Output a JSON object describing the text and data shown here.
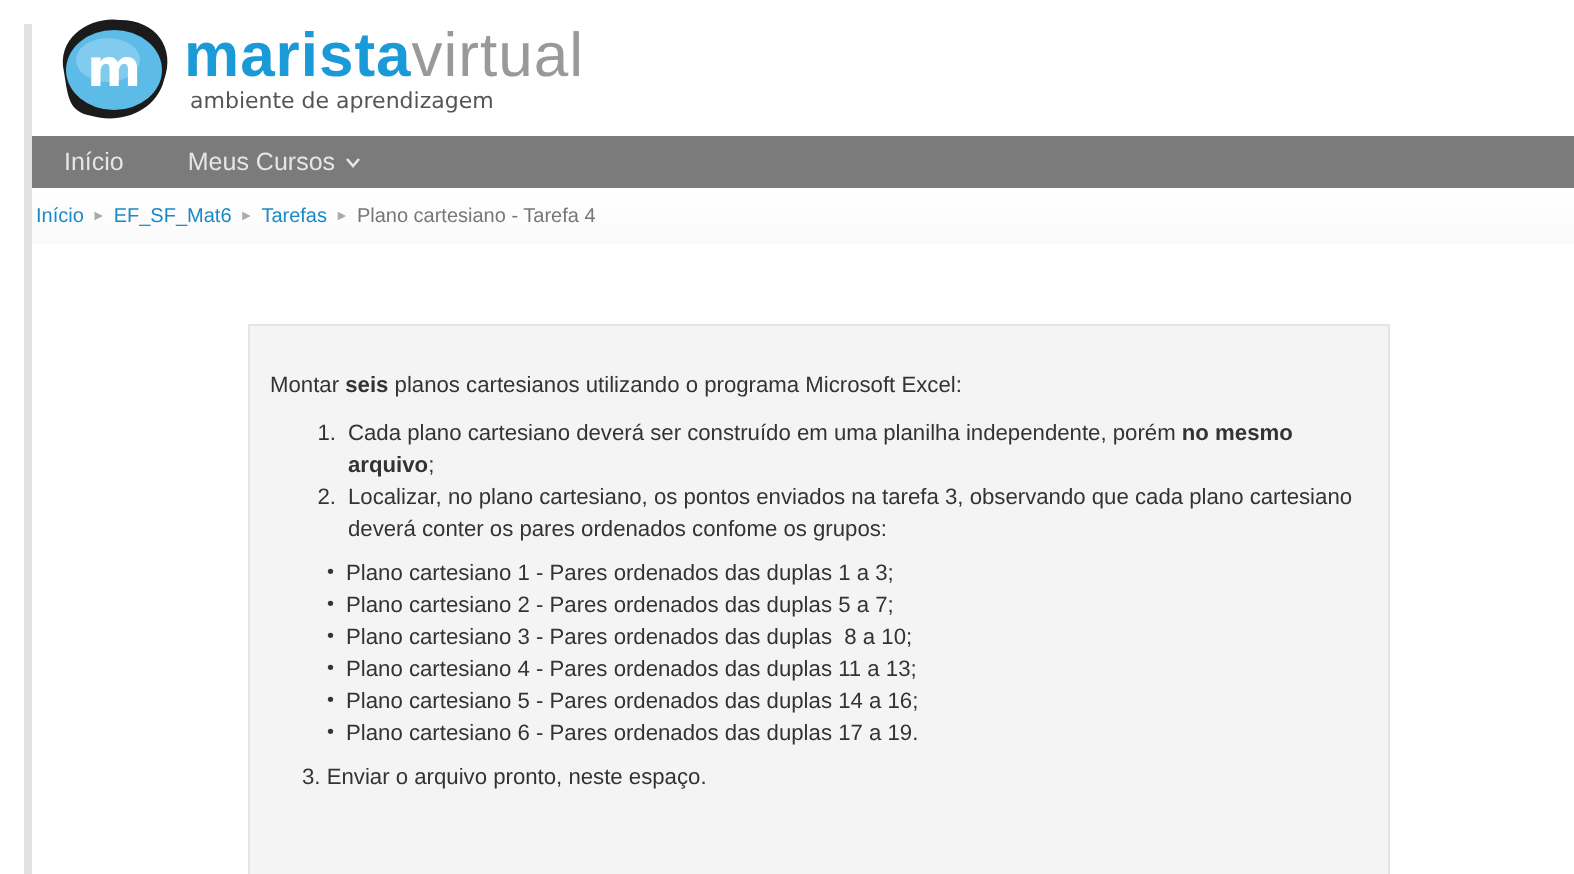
{
  "logo": {
    "brand_bold": "marista",
    "brand_light": "virtual",
    "tagline": "ambiente de aprendizagem",
    "mark": "m"
  },
  "nav": [
    {
      "label": "Início",
      "dropdown": false
    },
    {
      "label": "Meus Cursos",
      "dropdown": true
    }
  ],
  "breadcrumb": [
    {
      "label": "Início",
      "link": true
    },
    {
      "label": "EF_SF_Mat6",
      "link": true
    },
    {
      "label": "Tarefas",
      "link": true
    },
    {
      "label": "Plano cartesiano - Tarefa 4",
      "link": false
    }
  ],
  "breadcrumb_separator": "►",
  "content": {
    "intro": "Montar **seis** planos cartesianos utilizando o programa Microsoft Excel:",
    "steps": [
      {
        "number": "1.",
        "text": "Cada plano cartesiano deverá ser construído em uma planilha independente, porém **no mesmo arquivo**;"
      },
      {
        "number": "2.",
        "text": "Localizar, no plano cartesiano, os pontos enviados na tarefa 3, observando que cada plano cartesiano deverá conter os pares ordenados confome os grupos:"
      }
    ],
    "bullets": [
      {
        "marker": "•",
        "text": "Plano cartesiano 1 - Pares ordenados das duplas 1 a 3;"
      },
      {
        "marker": "•",
        "text": "Plano cartesiano 2 - Pares ordenados das duplas 5 a 7;"
      },
      {
        "marker": "•",
        "text": "Plano cartesiano 3 - Pares ordenados das duplas  8 a 10;"
      },
      {
        "marker": "•",
        "text": "Plano cartesiano 4 - Pares ordenados das duplas 11 a 13;"
      },
      {
        "marker": "•",
        "text": "Plano cartesiano 5 - Pares ordenados das duplas 14 a 16;"
      },
      {
        "marker": "•",
        "text": "Plano cartesiano 6 - Pares ordenados das duplas 17 a 19."
      }
    ],
    "final": "3. Enviar o arquivo pronto, neste espaço."
  }
}
